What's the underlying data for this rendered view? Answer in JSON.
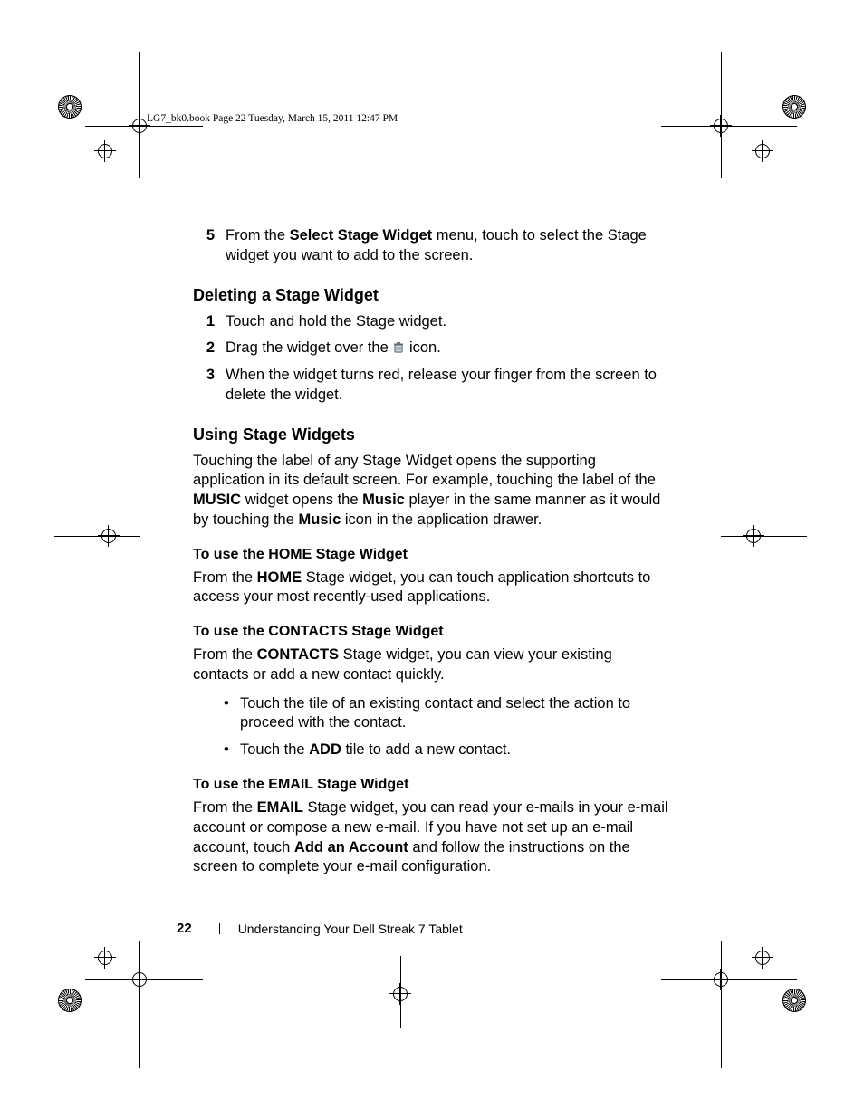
{
  "header": "LG7_bk0.book  Page 22  Tuesday, March 15, 2011  12:47 PM",
  "step5": {
    "num": "5",
    "pre": "From the ",
    "bold": "Select Stage Widget",
    "post": " menu, touch to select the Stage widget you want to add to the screen."
  },
  "deleting": {
    "title": "Deleting a Stage Widget",
    "steps": [
      {
        "num": "1",
        "text": "Touch and hold the Stage widget."
      },
      {
        "num": "2",
        "pre": "Drag the widget over the ",
        "post": " icon."
      },
      {
        "num": "3",
        "text": "When the widget turns red, release your finger from the screen to delete the widget."
      }
    ]
  },
  "using": {
    "title": "Using Stage Widgets",
    "para": {
      "a": "Touching the label of any Stage Widget opens the supporting application in its default screen. For example, touching the label of the ",
      "b": "MUSIC",
      "c": " widget opens the ",
      "d": "Music",
      "e": " player in the same manner as it would by touching the ",
      "f": "Music",
      "g": " icon in the application drawer."
    }
  },
  "home": {
    "title": "To use the HOME Stage Widget",
    "para": {
      "a": "From the ",
      "b": "HOME",
      "c": " Stage widget, you can touch application shortcuts to access your most recently-used applications."
    }
  },
  "contacts": {
    "title": "To use the CONTACTS Stage Widget",
    "para": {
      "a": "From the ",
      "b": "CONTACTS",
      "c": " Stage widget, you can view your existing contacts or add a new contact quickly."
    },
    "bullets": [
      {
        "text": "Touch the tile of an existing contact and select the action to proceed with the contact."
      },
      {
        "a": "Touch the ",
        "b": "ADD",
        "c": " tile to add a new contact."
      }
    ]
  },
  "email": {
    "title": "To use the EMAIL Stage Widget",
    "para": {
      "a": "From the ",
      "b": "EMAIL",
      "c": " Stage widget, you can read your e-mails in your e-mail account or compose a new e-mail. If you have not set up an e-mail account, touch ",
      "d": "Add an Account",
      "e": " and follow the instructions on the screen to complete your e-mail configuration."
    }
  },
  "footer": {
    "page": "22",
    "chapter": "Understanding Your Dell Streak 7 Tablet"
  }
}
